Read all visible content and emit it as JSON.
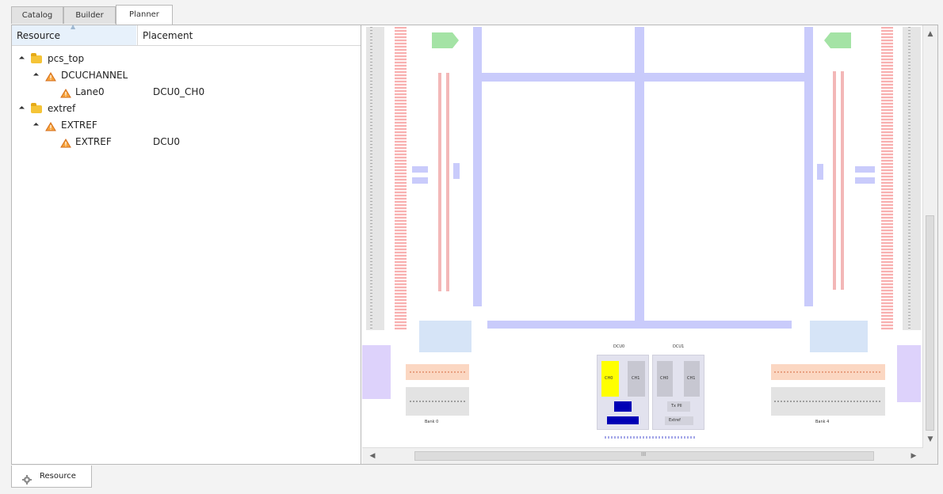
{
  "tabs": [
    {
      "label": "Catalog"
    },
    {
      "label": "Builder"
    },
    {
      "label": "Planner",
      "active": true
    }
  ],
  "tree": {
    "columns": [
      "Resource",
      "Placement"
    ],
    "rows": [
      {
        "indent": 0,
        "icon": "folder-icon",
        "label": "pcs_top",
        "placement": ""
      },
      {
        "indent": 1,
        "icon": "warning-icon",
        "label": "DCUCHANNEL",
        "placement": ""
      },
      {
        "indent": 2,
        "icon": "warning-icon",
        "label": "Lane0",
        "placement": "DCU0_CH0"
      },
      {
        "indent": 0,
        "icon": "folder-icon",
        "label": "extref",
        "placement": ""
      },
      {
        "indent": 1,
        "icon": "warning-icon",
        "label": "EXTREF",
        "placement": ""
      },
      {
        "indent": 2,
        "icon": "warning-icon",
        "label": "EXTREF",
        "placement": "DCU0"
      }
    ]
  },
  "planner": {
    "dcu_labels": [
      "DCU0",
      "DCU1"
    ],
    "channel_labels": [
      "CH0",
      "CH1",
      "CH0",
      "CH1"
    ],
    "small_labels": [
      "Tx PII",
      "Extref"
    ],
    "bank_labels": [
      "Bank 0",
      "Bank 4"
    ]
  },
  "scrollbars": {
    "horizontal_thumb_label": "III"
  },
  "bottom_tab": {
    "label": "Resource"
  },
  "colors": {
    "selected_channel": "#ffff00",
    "rail": "#c9cbfb",
    "dcu_gray": "#c7c7d1",
    "accent_blue": "#0000b5",
    "purple": "#ddd2fb"
  }
}
